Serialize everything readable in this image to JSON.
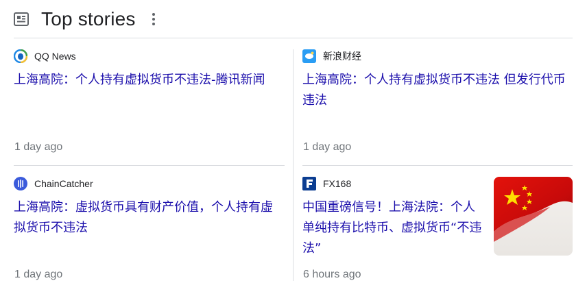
{
  "header": {
    "title": "Top stories",
    "icon": "newspaper-icon",
    "more_icon": "more-vert-icon"
  },
  "colors": {
    "link": "#1a0dab",
    "meta": "#70757a",
    "divider": "#dadce0"
  },
  "stories": [
    {
      "source": "QQ News",
      "source_icon": "qq-news-logo",
      "headline": "上海高院：个人持有虚拟货币不违法-腾讯新闻",
      "time": "1 day ago"
    },
    {
      "source": "新浪财经",
      "source_icon": "sina-finance-logo",
      "headline": "上海高院：个人持有虚拟货币不违法 但发行代币违法",
      "time": "1 day ago"
    },
    {
      "source": "ChainCatcher",
      "source_icon": "chaincatcher-logo",
      "headline": "上海高院：虚拟货币具有财产价值，个人持有虚拟货币不违法",
      "time": "1 day ago"
    },
    {
      "source": "FX168",
      "source_icon": "fx168-logo",
      "headline": "中国重磅信号！上海法院：个人单纯持有比特币、虚拟货币“不违法”",
      "time": "6 hours ago",
      "thumbnail": "china-flag-thumbnail"
    }
  ]
}
